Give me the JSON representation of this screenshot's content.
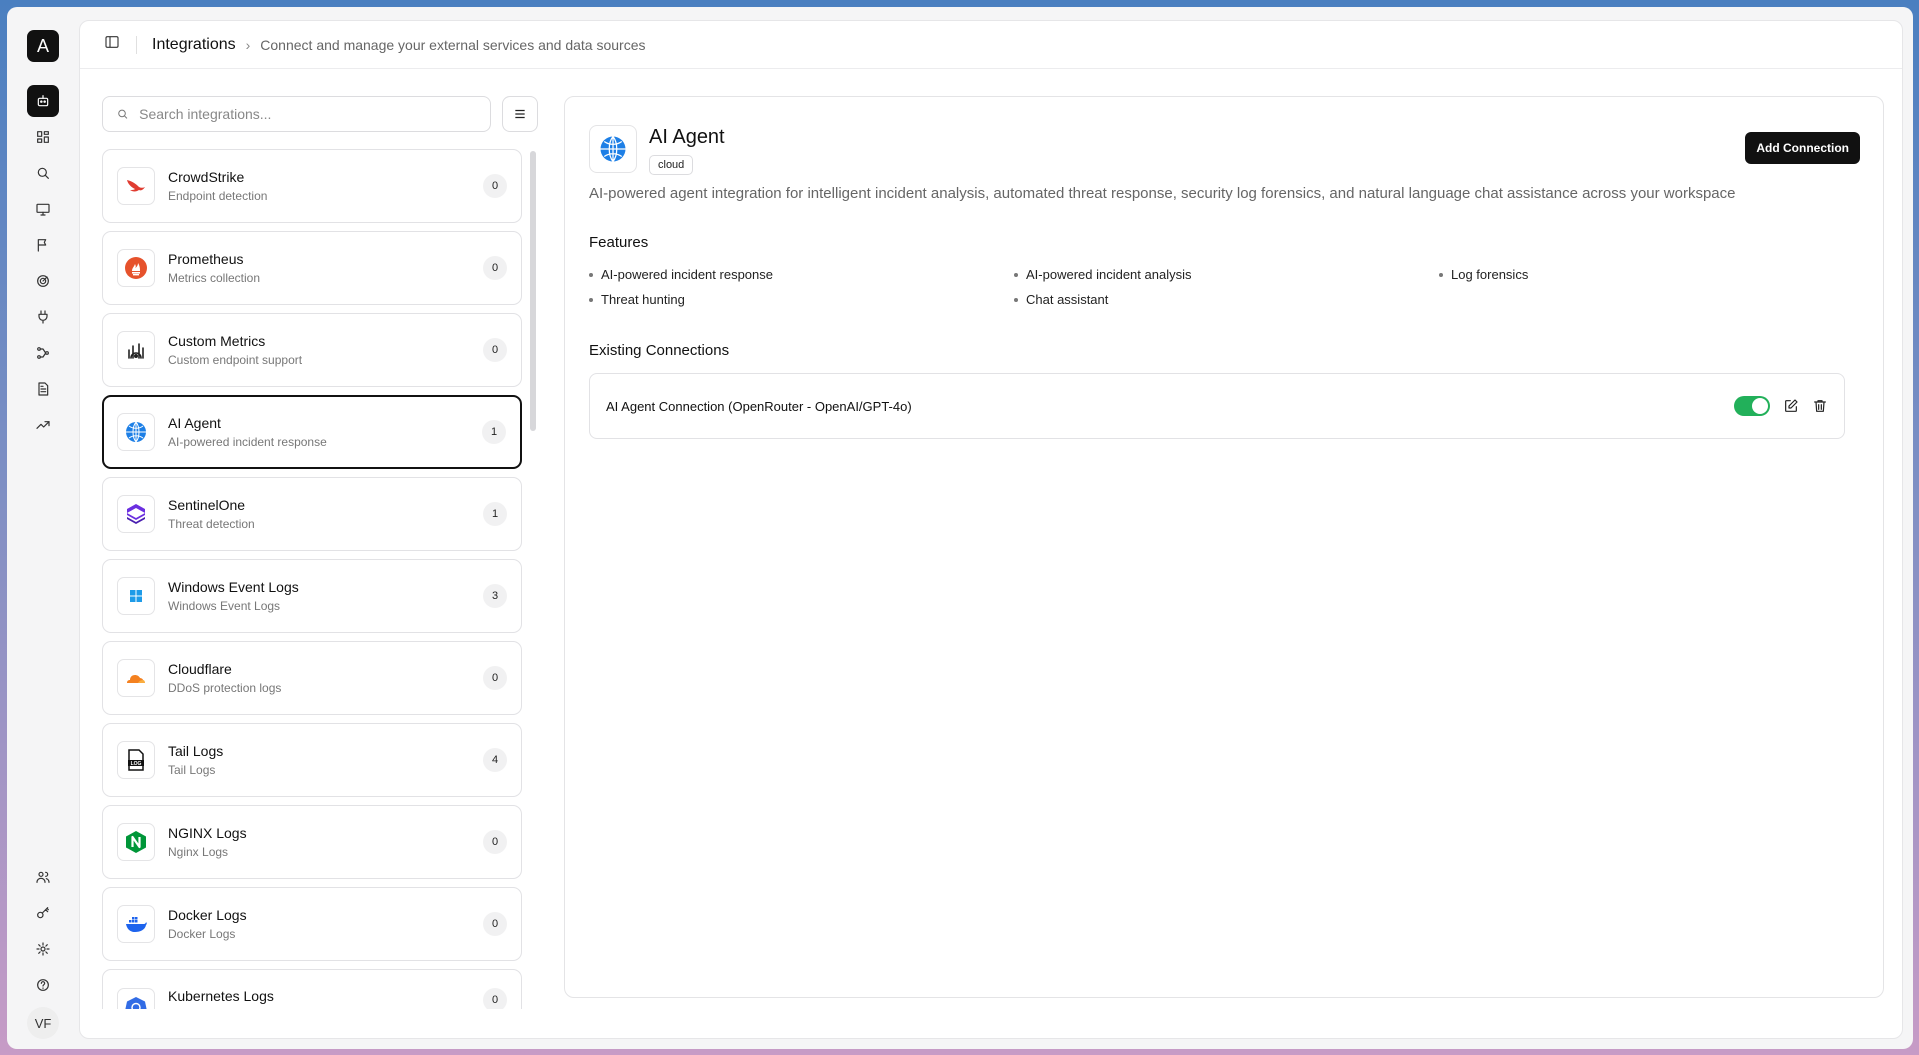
{
  "app": {
    "logo_letter": "A",
    "user_initials": "VF"
  },
  "rail": {
    "top_items": [
      "robot-icon",
      "dashboard-icon",
      "search-icon",
      "monitor-icon",
      "flag-icon",
      "radar-icon",
      "plug-icon",
      "workflow-icon",
      "document-icon",
      "trend-icon"
    ],
    "bottom_items": [
      "users-icon",
      "key-icon",
      "gear-icon",
      "help-icon"
    ],
    "active": "robot-icon"
  },
  "header": {
    "title": "Integrations",
    "subtitle": "Connect and manage your external services and data sources"
  },
  "search": {
    "placeholder": "Search integrations..."
  },
  "integrations": [
    {
      "name": "CrowdStrike",
      "desc": "Endpoint detection",
      "count": "0",
      "icon": "crowdstrike-icon"
    },
    {
      "name": "Prometheus",
      "desc": "Metrics collection",
      "count": "0",
      "icon": "prometheus-icon"
    },
    {
      "name": "Custom Metrics",
      "desc": "Custom endpoint support",
      "count": "0",
      "icon": "custom-metrics-icon"
    },
    {
      "name": "AI Agent",
      "desc": "AI-powered incident response",
      "count": "1",
      "icon": "ai-agent-icon",
      "selected": true
    },
    {
      "name": "SentinelOne",
      "desc": "Threat detection",
      "count": "1",
      "icon": "sentinelone-icon"
    },
    {
      "name": "Windows Event Logs",
      "desc": "Windows Event Logs",
      "count": "3",
      "icon": "windows-icon"
    },
    {
      "name": "Cloudflare",
      "desc": "DDoS protection logs",
      "count": "0",
      "icon": "cloudflare-icon"
    },
    {
      "name": "Tail Logs",
      "desc": "Tail Logs",
      "count": "4",
      "icon": "log-file-icon"
    },
    {
      "name": "NGINX Logs",
      "desc": "Nginx Logs",
      "count": "0",
      "icon": "nginx-icon"
    },
    {
      "name": "Docker Logs",
      "desc": "Docker Logs",
      "count": "0",
      "icon": "docker-icon"
    },
    {
      "name": "Kubernetes Logs",
      "desc": "",
      "count": "0",
      "icon": "kubernetes-icon"
    }
  ],
  "detail": {
    "title": "AI Agent",
    "tag": "cloud",
    "add_button": "Add Connection",
    "description": "AI-powered agent integration for intelligent incident analysis, automated threat response, security log forensics, and natural language chat assistance across your workspace",
    "features_title": "Features",
    "features": [
      "AI-powered incident response",
      "AI-powered incident analysis",
      "Log forensics",
      "Threat hunting",
      "Chat assistant"
    ],
    "connections_title": "Existing Connections",
    "connections": [
      {
        "name": "AI Agent Connection (OpenRouter - OpenAI/GPT-4o)",
        "enabled": true
      }
    ]
  },
  "colors": {
    "accent": "#111111",
    "toggle_on": "#22b05a"
  }
}
